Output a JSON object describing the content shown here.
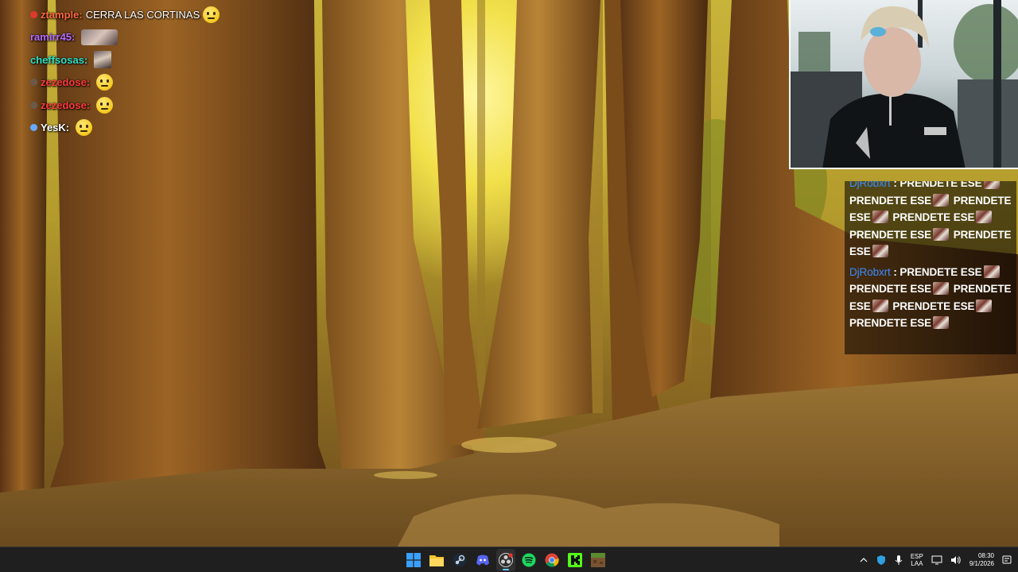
{
  "chat_left": {
    "messages": [
      {
        "user": "ztample:",
        "text": "CERRA LAS CORTINAS",
        "color": "#ff6a3d",
        "badge_color": "#e0392f",
        "emote": "face"
      },
      {
        "user": "ramirr45:",
        "text": "",
        "color": "#b86bff",
        "badge_color": "",
        "emote": "thumb"
      },
      {
        "user": "cheffsosas:",
        "text": "",
        "color": "#2fe0c6",
        "badge_color": "",
        "emote": "square"
      },
      {
        "user": "zezedose:",
        "text": "",
        "color": "#ff3b3b",
        "badge_color": "#6b5a4a",
        "emote": "face"
      },
      {
        "user": "zezedose:",
        "text": "",
        "color": "#ff3b3b",
        "badge_color": "#6b5a4a",
        "emote": "face"
      },
      {
        "user": "YesK:",
        "text": "",
        "color": "#ffffff",
        "badge_color": "#66aaff",
        "emote": "face"
      }
    ]
  },
  "chat_right": {
    "messages": [
      {
        "user": "DjRobxrt",
        "text": "PRENDETE ESE"
      },
      {
        "user": "DjRobxrt",
        "text": "PRENDETE ESE"
      }
    ],
    "repeat_count": 9
  },
  "taskbar": {
    "apps": [
      {
        "name": "start-button",
        "icon": "windows-icon",
        "active": false
      },
      {
        "name": "file-explorer-button",
        "icon": "folder-icon",
        "active": false
      },
      {
        "name": "steam-button",
        "icon": "steam-icon",
        "active": false
      },
      {
        "name": "discord-button",
        "icon": "discord-icon",
        "active": false
      },
      {
        "name": "obs-button",
        "icon": "obs-icon",
        "active": true
      },
      {
        "name": "spotify-button",
        "icon": "spotify-icon",
        "active": false
      },
      {
        "name": "chrome-button",
        "icon": "chrome-icon",
        "active": false
      },
      {
        "name": "kick-button",
        "icon": "kick-icon",
        "active": false
      },
      {
        "name": "minecraft-button",
        "icon": "minecraft-icon",
        "active": false
      }
    ],
    "tray": {
      "lang_line1": "ESP",
      "lang_line2": "LAA",
      "time": "08:30",
      "date": "9/1/2026"
    }
  }
}
